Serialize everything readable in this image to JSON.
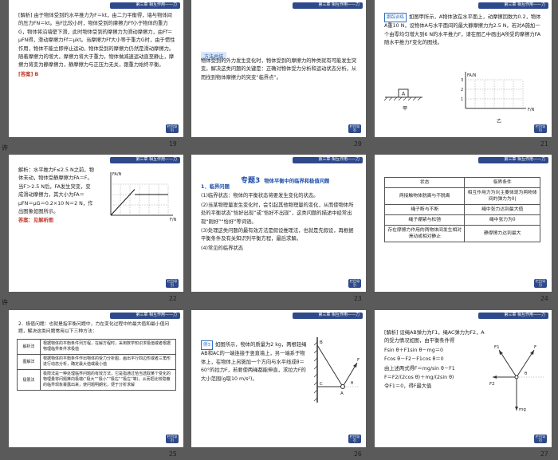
{
  "header_text": "第三章 相互作用——力",
  "back_label": "栏目导引",
  "strip_labels": [
    "许",
    "许"
  ],
  "slides": {
    "s19": {
      "page": "19",
      "lines": [
        "[解析] 由于物体受到的水平推力为F＝kt，由二力平衡得，墙与物体间的压力FN＝kt。当F比较小时，物体受到的摩擦力Ff小于物体的重力G，物体将沿墙壁下滑，此时物体受到的摩擦力为滑动摩擦力，由Ff＝μFN得，滑动摩擦力Ff＝μkt。当摩擦力Ff大小等于重力G时，由于惯性作用，物体不能立即停止运动，物体受到的摩擦力仍然是滑动摩擦力。随着摩擦力的增大，摩擦力将大于重力，物体做减速运动直至静止，摩擦力将变为静摩擦力，静摩擦力与正压力无关，跟重力始终平衡。"
      ],
      "answer": "[答案] B"
    },
    "s20": {
      "page": "20",
      "method_title": "方法总结",
      "text": "物体受到的外力发生变化时，物体受到的摩擦力的种类就有可能发生突变。解决这类问题的关键是：正确对物体受力分析和运动状态分析，从而找到物体摩擦力的突变“临界点”。"
    },
    "s21": {
      "page": "21",
      "tag": "跟踪训练",
      "text": "如图甲所示，A物体放在水平面上，动摩擦因数为0.2，物体A重10 N，设物体A与水平面间的最大静摩擦力为2.5 N，若对A施加一个由零均匀增大到6 N的水平推力F，请在图乙中画出A所受的摩擦力FA随水平推力F变化的图线。",
      "fig_a": "甲",
      "fig_b": "乙",
      "axis_y": "FA/N",
      "axis_x": "F/N",
      "yticks": [
        "3",
        "2",
        "1"
      ],
      "xticks": [
        "0",
        "1",
        "2",
        "3",
        "4",
        "5",
        "6"
      ]
    },
    "s22": {
      "page": "22",
      "text": "解析：水平推力F≤2.5 N之前，物体未动，物体受静摩擦力FA＝F。当F＞2.5 N后，FA发生突变，变成滑动摩擦力，其大小为FA＝μFN＝μG＝0.2×10 N＝2 N，作出图象如图所示。",
      "answer": "答案：见解析图",
      "axis_y": "FA/N",
      "axis_x": "F/N"
    },
    "s23": {
      "page": "23",
      "topic_no": "专题3",
      "topic_title": "物体平衡中的临界和极值问题",
      "sub1": "1．临界问题",
      "items": [
        "(1)临界状态：物体的平衡状态将要发生变化的状态。",
        "(2)当某物理量发生变化时，会引起其他物理量的变化，从而使物体所处的平衡状态“恰好出现”或“恰好不出现”，这类问题的描述中经常出现“刚好”“恰好”等词语。",
        "(3)处理这类问题的最有效方法是假设推理法，也就是先假设，再根据平衡条件及有关知识列平衡方程，最后求解。",
        "(4)常见的临界状态"
      ]
    },
    "s24": {
      "page": "24",
      "headers": [
        "状态",
        "临界条件"
      ],
      "rows": [
        [
          "两接触物体脱离与不脱离",
          "相互作用力为0(主要体现为两物体间的弹力为0)"
        ],
        [
          "绳子断与不断",
          "绳中张力达到最大值"
        ],
        [
          "绳子绷紧与松弛",
          "绳中张力为0"
        ],
        [
          "存在摩擦力作用的两物体间发生相对滑动或相对静止",
          "静摩擦力达到最大"
        ]
      ]
    },
    "s25": {
      "page": "25",
      "intro": "2．极值问题：也就是指平衡问题中，力在变化过程中的最大值和最小值问题，解决这类问题常用以下三种方法：",
      "rows": [
        [
          "解析法",
          "根据物体的平衡条件列方程，在解方程时，采用数学知识求极值或者根据物理临界条件求极值"
        ],
        [
          "图解法",
          "根据物体的平衡条件作出物体的受力分析图，画出平行四边形或者三角形进行动态分析，确定最大值或最小值"
        ],
        [
          "极限法",
          "极限法是一种处理临界问题的有效方法，它是指通过恰当选取某个变化的物理量将问题推向极端(“极大”“极小”“极右”“极左”等)，从而把比较隐蔽的临界现象暴露出来，使问题明朗化，便于分析求解"
        ]
      ]
    },
    "s26": {
      "page": "26",
      "tag": "例3",
      "text": "如图所示，物体的质量为2 kg，两根轻绳AB和AC的一端连接于竖直墙上，另一端系于物体上，在物体上另施加一个方向与水平线成θ＝60°的拉力F，若要使两绳都能伸直，求拉力F的大小范围(g取10 m/s²)。",
      "labels": [
        "B",
        "C",
        "A",
        "F",
        "θ"
      ]
    },
    "s27": {
      "page": "27",
      "lines": [
        "[解析] 设绳AB弹力为F1，绳AC弹力为F2，A的受力情况如图，由平衡条件得",
        "Fsin θ＋F1sin θ－mg＝0",
        "Fcos θ－F2－F1cos θ＝0",
        "由上述两式得F＝mg/sin θ－F1",
        "F＝F2/(2cos θ)＋mg/(2sin θ)",
        "令F1＝0，得F最大值"
      ],
      "labels": [
        "F",
        "F1",
        "F2",
        "mg",
        "θ"
      ]
    }
  }
}
